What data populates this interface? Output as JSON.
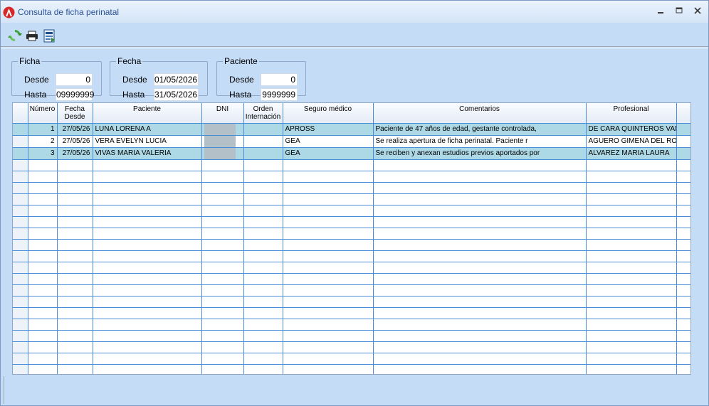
{
  "window": {
    "title": "Consulta de ficha perinatal",
    "icon": "app-logo-icon",
    "controls": [
      "minimize-icon",
      "maximize-icon",
      "close-icon"
    ]
  },
  "toolbar": {
    "buttons": [
      {
        "name": "refresh-button",
        "icon": "refresh-icon"
      },
      {
        "name": "print-button",
        "icon": "printer-icon"
      },
      {
        "name": "export-button",
        "icon": "export-icon"
      }
    ]
  },
  "filters": {
    "ficha": {
      "legend": "Ficha",
      "desde_label": "Desde",
      "desde": "0",
      "hasta_label": "Hasta",
      "hasta": "09999999"
    },
    "fecha": {
      "legend": "Fecha",
      "desde_label": "Desde",
      "desde": "01/05/2026",
      "hasta_label": "Hasta",
      "hasta": "31/05/2026"
    },
    "paciente": {
      "legend": "Paciente",
      "desde_label": "Desde",
      "desde": "0",
      "hasta_label": "Hasta",
      "hasta": "9999999"
    }
  },
  "grid": {
    "columns": [
      "Número",
      "Fecha Desde",
      "Paciente",
      "DNI",
      "Orden Internación",
      "Seguro médico",
      "Comentarios",
      "Profesional"
    ],
    "rows": [
      {
        "numero": "1",
        "fecha": "27/05/26",
        "paciente": "LUNA LORENA A",
        "dni": "",
        "orden": "",
        "seguro": "APROSS",
        "comentarios": "Paciente de 47 años de edad, gestante controlada,",
        "profesional": "DE CARA QUINTEROS VAN"
      },
      {
        "numero": "2",
        "fecha": "27/05/26",
        "paciente": "VERA EVELYN LUCIA",
        "dni": "",
        "orden": "",
        "seguro": "GEA",
        "comentarios": "Se realiza apertura de ficha perinatal. Paciente r",
        "profesional": "AGUERO GIMENA DEL ROS"
      },
      {
        "numero": "3",
        "fecha": "27/05/26",
        "paciente": "VIVAS MARIA VALERIA",
        "dni": "",
        "orden": "",
        "seguro": "GEA",
        "comentarios": "Se reciben y anexan estudios previos aportados por",
        "profesional": "ALVAREZ MARIA LAURA"
      }
    ],
    "empty_rows": 19
  },
  "colors": {
    "window_bg": "#c5dcf7",
    "grid_line": "#4a8ed8",
    "alt_row": "#add8e6",
    "title_text": "#2a5298"
  }
}
